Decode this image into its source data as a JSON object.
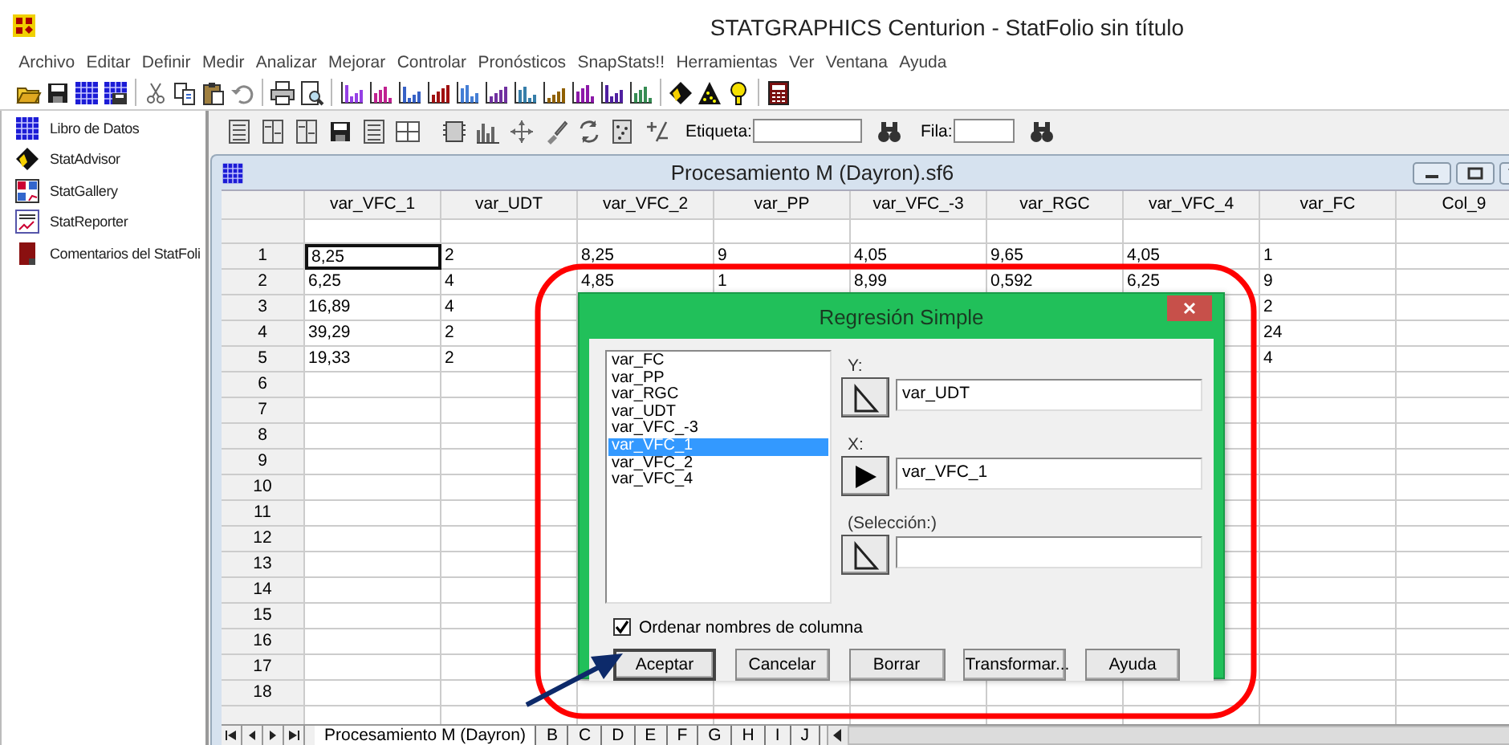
{
  "app": {
    "title": "STATGRAPHICS Centurion - StatFolio sin título"
  },
  "menu": [
    "Archivo",
    "Editar",
    "Definir",
    "Medir",
    "Analizar",
    "Mejorar",
    "Controlar",
    "Pronósticos",
    "SnapStats!!",
    "Herramientas",
    "Ver",
    "Ventana",
    "Ayuda"
  ],
  "sidebar": {
    "items": [
      {
        "label": "Libro de Datos",
        "kind": "datasheet"
      },
      {
        "label": "StatAdvisor",
        "kind": "advisor"
      },
      {
        "label": "StatGallery",
        "kind": "gallery"
      },
      {
        "label": "StatReporter",
        "kind": "reporter"
      },
      {
        "label": "Comentarios del StatFoli",
        "kind": "notes"
      }
    ]
  },
  "data_toolbar": {
    "label_field": {
      "label": "Etiqueta:"
    },
    "row_field": {
      "label": "Fila:"
    }
  },
  "datasheet": {
    "title": "Procesamiento M (Dayron).sf6",
    "columns": [
      "var_VFC_1",
      "var_UDT",
      "var_VFC_2",
      "var_PP",
      "var_VFC_-3",
      "var_RGC",
      "var_VFC_4",
      "var_FC",
      "Col_9"
    ],
    "rows": [
      {
        "number": "1",
        "cells": [
          {
            "text": "8,25",
            "selected": true
          },
          {
            "text": "2",
            "selected": false
          },
          {
            "text": "8,25",
            "selected": false
          },
          {
            "text": "9",
            "selected": false
          },
          {
            "text": "4,05",
            "selected": false
          },
          {
            "text": "9,65",
            "selected": false
          },
          {
            "text": "4,05",
            "selected": false
          },
          {
            "text": "1",
            "selected": false
          },
          {
            "selected": false
          }
        ]
      },
      {
        "number": "2",
        "cells": [
          {
            "text": "6,25",
            "selected": false
          },
          {
            "text": "4",
            "selected": false
          },
          {
            "text": "4,85",
            "selected": false
          },
          {
            "text": "1",
            "selected": false
          },
          {
            "text": "8,99",
            "selected": false
          },
          {
            "text": "0,592",
            "selected": false
          },
          {
            "text": "6,25",
            "selected": false
          },
          {
            "text": "9",
            "selected": false
          },
          {
            "selected": false
          }
        ]
      },
      {
        "number": "3",
        "cells": [
          {
            "text": "16,89",
            "selected": false
          },
          {
            "text": "4",
            "selected": false
          },
          null,
          null,
          null,
          null,
          {
            "selected": false
          },
          {
            "text": "2",
            "selected": false
          },
          {
            "selected": false
          }
        ]
      },
      {
        "number": "4",
        "cells": [
          {
            "text": "39,29",
            "selected": false
          },
          {
            "text": "2",
            "selected": false
          },
          null,
          null,
          null,
          null,
          {
            "selected": false
          },
          {
            "text": "24",
            "selected": false
          },
          {
            "selected": false
          }
        ]
      },
      {
        "number": "5",
        "cells": [
          {
            "text": "19,33",
            "selected": false
          },
          {
            "text": "2",
            "selected": false
          },
          null,
          null,
          null,
          null,
          {
            "selected": false
          },
          {
            "text": "4",
            "selected": false
          },
          {
            "selected": false
          }
        ]
      },
      {
        "number": "6"
      },
      {
        "number": "7"
      },
      {
        "number": "8"
      },
      {
        "number": "9"
      },
      {
        "number": "10"
      },
      {
        "number": "11"
      },
      {
        "number": "12"
      },
      {
        "number": "13"
      },
      {
        "number": "14"
      },
      {
        "number": "15"
      },
      {
        "number": "16"
      },
      {
        "number": "17"
      },
      {
        "number": "18"
      }
    ],
    "sheet_tabs": [
      {
        "label": "Procesamiento M (Dayron)",
        "selected": true
      },
      {
        "label": "B",
        "selected": false
      },
      {
        "label": "C",
        "selected": false
      },
      {
        "label": "D",
        "selected": false
      },
      {
        "label": "E",
        "selected": false
      },
      {
        "label": "F",
        "selected": false
      },
      {
        "label": "G",
        "selected": false
      },
      {
        "label": "H",
        "selected": false
      },
      {
        "label": "I",
        "selected": false
      },
      {
        "label": "J",
        "selected": false
      }
    ]
  },
  "dialog": {
    "title": "Regresión Simple",
    "variables": [
      {
        "label": "var_FC",
        "selected": false
      },
      {
        "label": "var_PP",
        "selected": false
      },
      {
        "label": "var_RGC",
        "selected": false
      },
      {
        "label": "var_UDT",
        "selected": false
      },
      {
        "label": "var_VFC_-3",
        "selected": false
      },
      {
        "label": "var_VFC_1",
        "selected": true
      },
      {
        "label": "var_VFC_2",
        "selected": false
      },
      {
        "label": "var_VFC_4",
        "selected": false
      }
    ],
    "fields": [
      {
        "label": "Y:",
        "value": "var_UDT",
        "active": false
      },
      {
        "label": "X:",
        "value": "var_VFC_1",
        "active": true
      },
      {
        "label": "(Selección:)",
        "active": false
      }
    ],
    "sort_names": {
      "label": "Ordenar nombres de columna",
      "checked": true
    },
    "buttons": [
      {
        "label": "Aceptar",
        "default": true
      },
      {
        "label": "Cancelar",
        "default": false
      },
      {
        "label": "Borrar",
        "default": false
      },
      {
        "label": "Transformar...",
        "default": false
      },
      {
        "label": "Ayuda",
        "default": false
      }
    ]
  }
}
